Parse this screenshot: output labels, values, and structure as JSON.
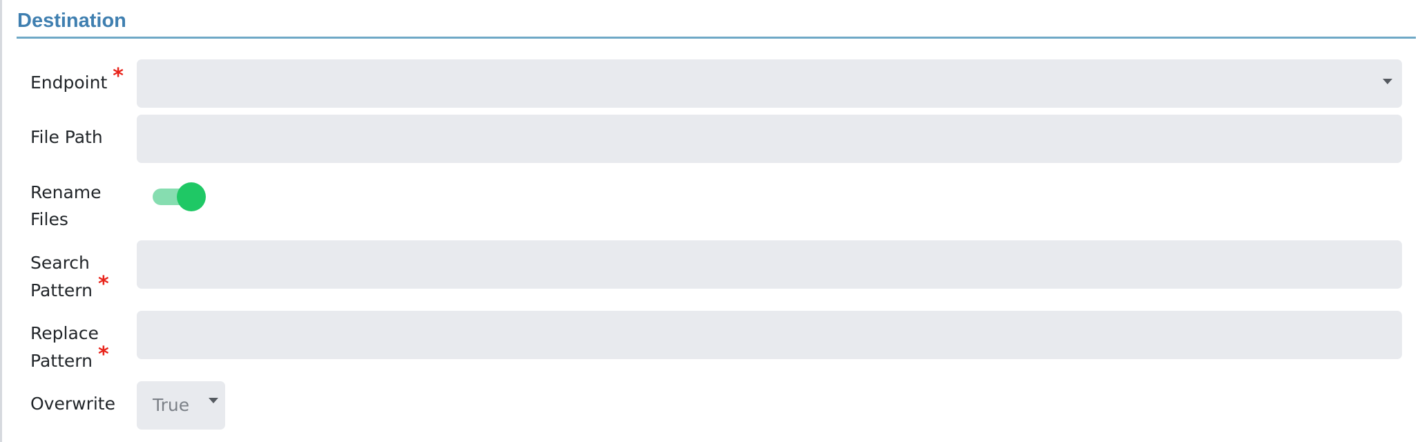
{
  "section": {
    "title": "Destination"
  },
  "fields": {
    "endpoint": {
      "label": "Endpoint",
      "required_mark": "*",
      "value": ""
    },
    "file_path": {
      "label": "File Path",
      "value": ""
    },
    "rename_files": {
      "label_line1": "Rename",
      "label_line2": "Files",
      "enabled": true
    },
    "search_pattern": {
      "label_line1": "Search",
      "label_line2": "Pattern",
      "required_mark": "*",
      "value": ""
    },
    "replace_pattern": {
      "label_line1": "Replace",
      "label_line2": "Pattern",
      "required_mark": "*",
      "value": ""
    },
    "overwrite": {
      "label": "Overwrite",
      "value": "True"
    }
  },
  "colors": {
    "title": "#3f7fb0",
    "required": "#e8231a",
    "field_bg": "#e8eaee",
    "toggle_on": "#1fc865"
  },
  "icons": {
    "dropdown": "chevron-down-icon"
  }
}
